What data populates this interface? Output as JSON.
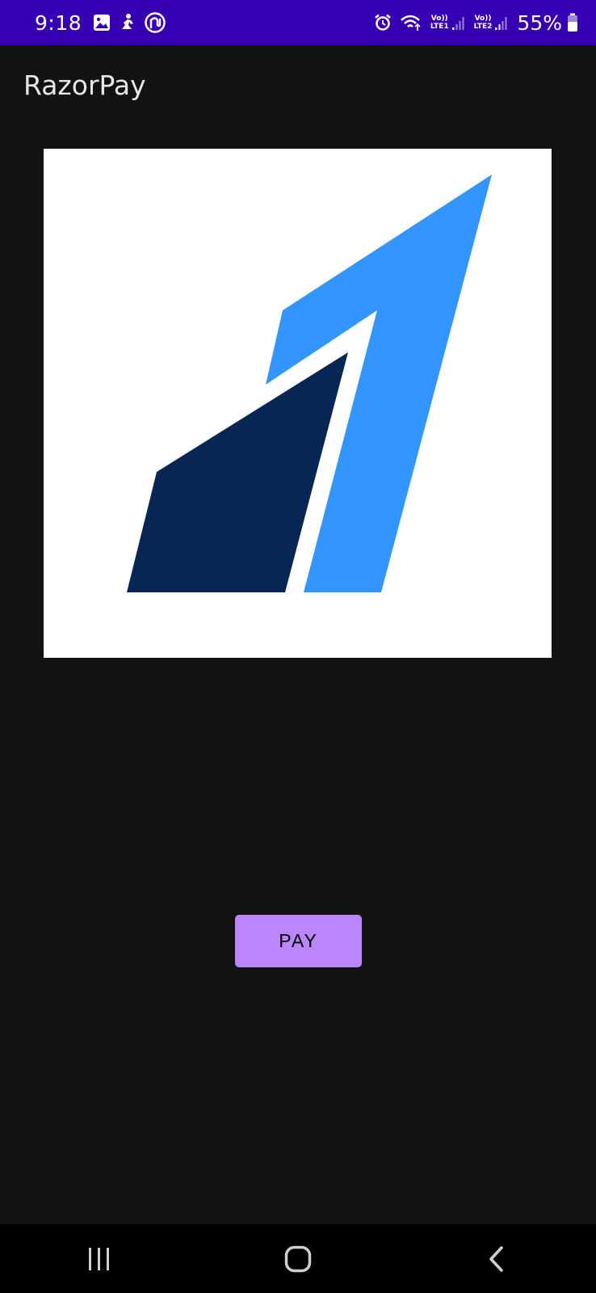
{
  "status_bar": {
    "time": "9:18",
    "sim1_label_top": "Vo))",
    "sim1_label_bottom": "LTE1",
    "sim2_label_top": "Vo))",
    "sim2_label_bottom": "LTE2",
    "battery_percent": "55%",
    "background_color": "#3700b3",
    "icons": [
      "gallery-icon",
      "activity-icon",
      "app-notification-icon",
      "alarm-icon",
      "wifi-icon",
      "signal-icon",
      "signal-icon",
      "battery-icon"
    ]
  },
  "app_bar": {
    "title": "RazorPay"
  },
  "main": {
    "logo": {
      "icon": "razorpay-logo",
      "colors": {
        "light": "#3395ff",
        "dark": "#072654"
      }
    },
    "pay_button_label": "PAY",
    "accent_color": "#bb86fc"
  },
  "nav_bar": {
    "icons": [
      "recent-apps-icon",
      "home-icon",
      "back-icon"
    ]
  }
}
